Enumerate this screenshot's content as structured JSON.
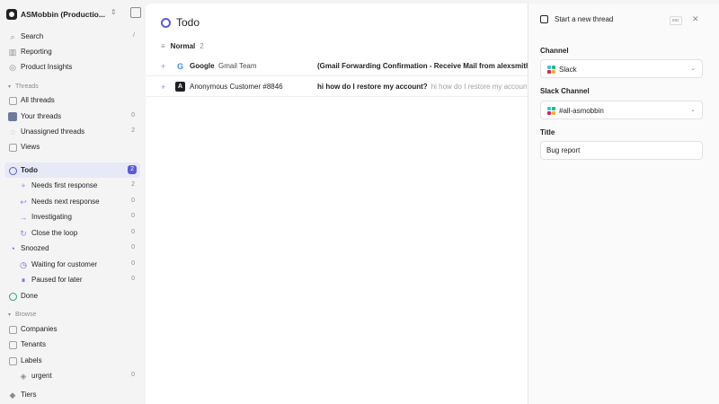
{
  "workspace": {
    "name": "ASMobbin (Productio..."
  },
  "top_nav": [
    {
      "label": "Search",
      "shortcut": "/",
      "icon": "search-icon"
    },
    {
      "label": "Reporting",
      "icon": "chart-icon"
    },
    {
      "label": "Product Insights",
      "icon": "insights-icon"
    }
  ],
  "sections": {
    "threads": "Threads",
    "browse": "Browse"
  },
  "thread_nav": [
    {
      "label": "All threads",
      "count": "",
      "icon": "inbox-icon"
    },
    {
      "label": "Your threads",
      "count": "0",
      "icon": "avatar-icon"
    },
    {
      "label": "Unassigned threads",
      "count": "2",
      "icon": "unassigned-icon"
    },
    {
      "label": "Views",
      "count": "",
      "icon": "views-icon"
    }
  ],
  "todo": {
    "label": "Todo",
    "count": "2"
  },
  "todo_sub": [
    {
      "label": "Needs first response",
      "count": "2",
      "icon": "plus-icon"
    },
    {
      "label": "Needs next response",
      "count": "0",
      "icon": "reply-icon"
    },
    {
      "label": "Investigating",
      "count": "0",
      "icon": "arrow-right-icon"
    },
    {
      "label": "Close the loop",
      "count": "0",
      "icon": "loop-icon"
    }
  ],
  "snoozed": {
    "label": "Snoozed",
    "count": "0"
  },
  "snoozed_sub": [
    {
      "label": "Waiting for customer",
      "count": "0",
      "icon": "waiting-icon"
    },
    {
      "label": "Paused for later",
      "count": "0",
      "icon": "pause-icon"
    }
  ],
  "done": {
    "label": "Done"
  },
  "browse_nav": [
    {
      "label": "Companies",
      "icon": "companies-icon"
    },
    {
      "label": "Tenants",
      "icon": "tenants-icon"
    },
    {
      "label": "Labels",
      "icon": "labels-icon"
    }
  ],
  "label_items": [
    {
      "label": "urgent",
      "count": "0"
    }
  ],
  "tiers": {
    "label": "Tiers"
  },
  "main": {
    "title": "Todo",
    "group": {
      "label": "Normal",
      "count": "2"
    },
    "rows": [
      {
        "company": "Google",
        "sender": "Gmail Team",
        "subject": "(Gmail Forwarding Confirmation - Receive Mail from alexsmith.mo",
        "preview": ""
      },
      {
        "company": "",
        "sender": "Anonymous Customer #8846",
        "subject": "hi how do I restore my account?",
        "preview": "hi how do I restore my account?"
      }
    ]
  },
  "panel": {
    "title": "Start a new thread",
    "esc": "esc",
    "channel_label": "Channel",
    "channel_value": "Slack",
    "slack_channel_label": "Slack Channel",
    "slack_channel_value": "#all-asmobbin",
    "title_label": "Title",
    "title_value": "Bug report"
  },
  "colors": {
    "accent": "#5b5bd6",
    "done": "#30a46c"
  }
}
